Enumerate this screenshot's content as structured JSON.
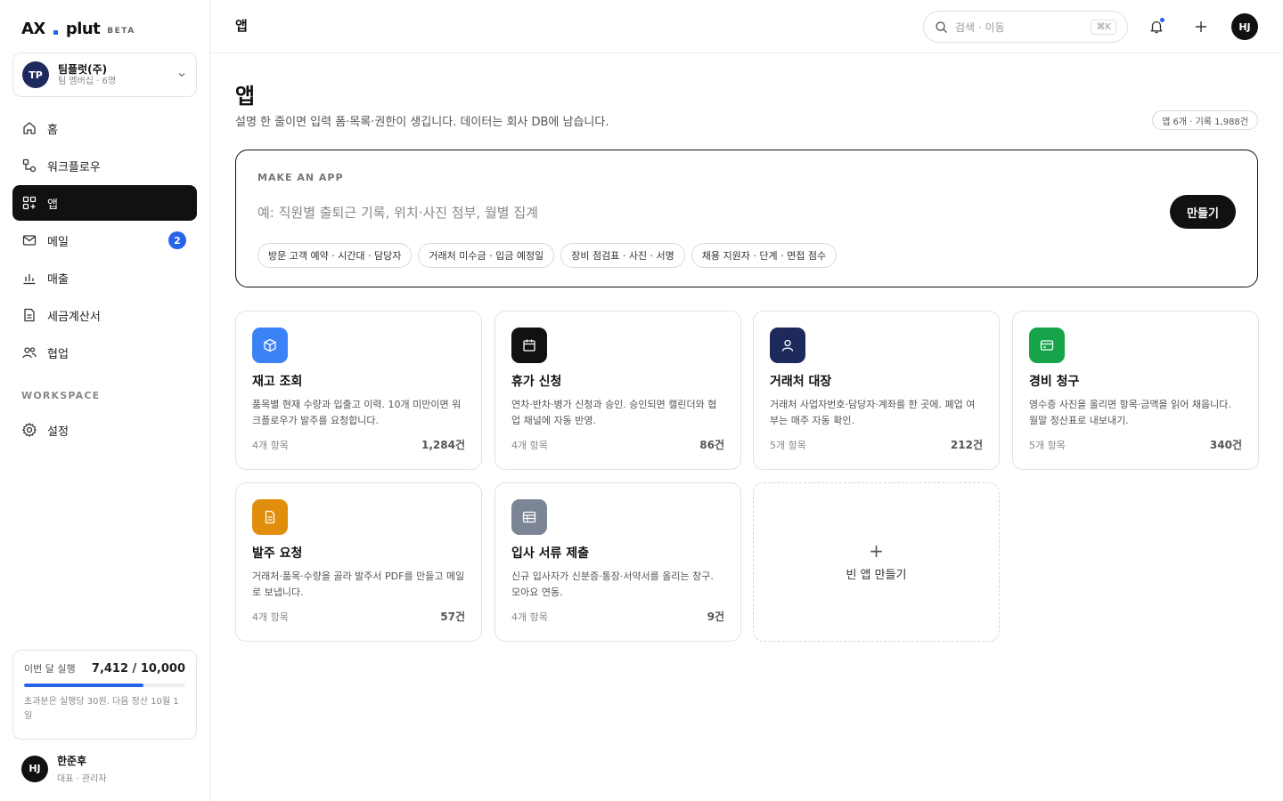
{
  "brand": {
    "name_left": "AX",
    "name_right": "plut",
    "tag": "BETA"
  },
  "team": {
    "initials": "TP",
    "name": "팀플럿(주)",
    "sub": "팀 멤버십 · 6명"
  },
  "sidebar": {
    "items": [
      {
        "label": "홈",
        "icon": "home-icon"
      },
      {
        "label": "워크플로우",
        "icon": "workflow-icon"
      },
      {
        "label": "앱",
        "icon": "apps-icon",
        "active": true
      },
      {
        "label": "메일",
        "icon": "mail-icon",
        "badge": "2"
      },
      {
        "label": "매출",
        "icon": "bar-chart-icon"
      },
      {
        "label": "세금계산서",
        "icon": "document-icon"
      },
      {
        "label": "협업",
        "icon": "users-icon"
      }
    ],
    "workspace_heading": "WORKSPACE",
    "workspace_items": [
      {
        "label": "설정",
        "icon": "gear-icon"
      }
    ]
  },
  "usage": {
    "label": "이번 달 실행",
    "value": "7,412 / 10,000",
    "progress": 0.7412,
    "note": "초과분은 실행당 30원. 다음 정산 10월 1일"
  },
  "user": {
    "initials": "HJ",
    "name": "한준후",
    "role": "대표 · 관리자"
  },
  "topbar": {
    "breadcrumb": "앱",
    "search_placeholder": "검색 · 이동",
    "search_shortcut": "⌘K",
    "avatar": "HJ"
  },
  "page": {
    "title": "앱",
    "description": "설명 한 줄이면 입력 폼·목록·권한이 생깁니다. 데이터는 회사 DB에 남습니다.",
    "stat": "앱 6개 · 기록 1,988건"
  },
  "maker": {
    "kicker": "MAKE AN APP",
    "placeholder": "예: 직원별 출퇴근 기록, 위치·사진 첨부, 월별 집계",
    "button": "만들기",
    "chips": [
      "방문 고객 예약 · 시간대 · 담당자",
      "거래처 미수금 · 입금 예정일",
      "장비 점검표 · 사진 · 서명",
      "채용 지원자 · 단계 · 면접 점수"
    ]
  },
  "apps": [
    {
      "title": "재고 조회",
      "desc": "품목별 현재 수량과 입출고 이력. 10개 미만이면 워크플로우가 발주를 요청합니다.",
      "meta": "4개 항목",
      "count": "1,284건",
      "icon": "box-icon",
      "color": "#3b82f6"
    },
    {
      "title": "휴가 신청",
      "desc": "연차·반차·병가 신청과 승인. 승인되면 캘린더와 협업 채널에 자동 반영.",
      "meta": "4개 항목",
      "count": "86건",
      "icon": "calendar-icon",
      "color": "#111111"
    },
    {
      "title": "거래처 대장",
      "desc": "거래처 사업자번호·담당자·계좌를 한 곳에. 폐업 여부는 매주 자동 확인.",
      "meta": "5개 항목",
      "count": "212건",
      "icon": "person-icon",
      "color": "#1f2a5c"
    },
    {
      "title": "경비 청구",
      "desc": "영수증 사진을 올리면 항목·금액을 읽어 채웁니다. 월말 정산표로 내보내기.",
      "meta": "5개 항목",
      "count": "340건",
      "icon": "card-icon",
      "color": "#16a34a"
    },
    {
      "title": "발주 요청",
      "desc": "거래처·품목·수량을 골라 발주서 PDF를 만들고 메일로 보냅니다.",
      "meta": "4개 항목",
      "count": "57건",
      "icon": "file-icon",
      "color": "#e08e0b"
    },
    {
      "title": "입사 서류 제출",
      "desc": "신규 입사자가 신분증·통장·서약서를 올리는 창구. 모아요 연동.",
      "meta": "4개 항목",
      "count": "9건",
      "icon": "table-icon",
      "color": "#7c8595"
    }
  ],
  "empty_card": {
    "plus": "+",
    "label": "빈 앱 만들기"
  }
}
